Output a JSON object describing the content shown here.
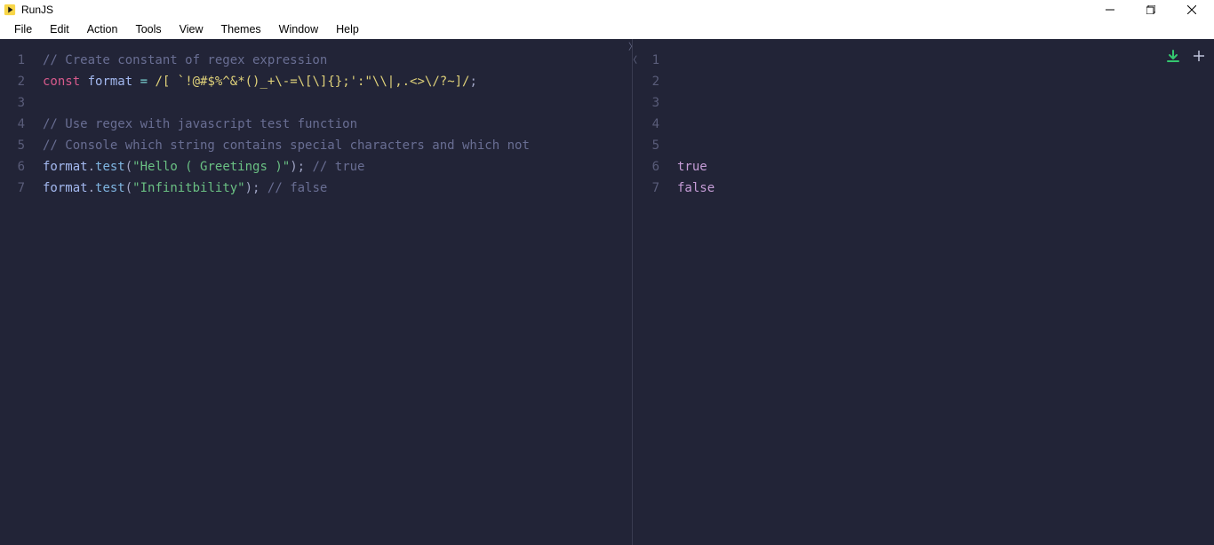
{
  "title_bar": {
    "app_name": "RunJS"
  },
  "menu": {
    "items": [
      "File",
      "Edit",
      "Action",
      "Tools",
      "View",
      "Themes",
      "Window",
      "Help"
    ]
  },
  "editor": {
    "lines": [
      {
        "num": "1",
        "tokens": [
          {
            "cls": "tok-comment",
            "t": "// Create constant of regex expression"
          }
        ]
      },
      {
        "num": "2",
        "tokens": [
          {
            "cls": "tok-keyword",
            "t": "const"
          },
          {
            "cls": "tok-default",
            "t": " "
          },
          {
            "cls": "tok-var",
            "t": "format"
          },
          {
            "cls": "tok-default",
            "t": " "
          },
          {
            "cls": "tok-op",
            "t": "="
          },
          {
            "cls": "tok-default",
            "t": " "
          },
          {
            "cls": "tok-regex",
            "t": "/[ `!@#$%^&*()_+\\-=\\[\\]{};':\"\\\\|,.<>\\/?~]/"
          },
          {
            "cls": "tok-punct",
            "t": ";"
          }
        ]
      },
      {
        "num": "3",
        "tokens": []
      },
      {
        "num": "4",
        "tokens": [
          {
            "cls": "tok-comment",
            "t": "// Use regex with javascript test function"
          }
        ]
      },
      {
        "num": "5",
        "tokens": [
          {
            "cls": "tok-comment",
            "t": "// Console which string contains special characters and which not"
          }
        ]
      },
      {
        "num": "6",
        "tokens": [
          {
            "cls": "tok-var",
            "t": "format"
          },
          {
            "cls": "tok-punct",
            "t": "."
          },
          {
            "cls": "tok-method",
            "t": "test"
          },
          {
            "cls": "tok-punct",
            "t": "("
          },
          {
            "cls": "tok-string",
            "t": "\"Hello ( Greetings )\""
          },
          {
            "cls": "tok-punct",
            "t": ");"
          },
          {
            "cls": "tok-default",
            "t": " "
          },
          {
            "cls": "tok-comment",
            "t": "// true"
          }
        ]
      },
      {
        "num": "7",
        "tokens": [
          {
            "cls": "tok-var",
            "t": "format"
          },
          {
            "cls": "tok-punct",
            "t": "."
          },
          {
            "cls": "tok-method",
            "t": "test"
          },
          {
            "cls": "tok-punct",
            "t": "("
          },
          {
            "cls": "tok-string",
            "t": "\"Infinitbility\""
          },
          {
            "cls": "tok-punct",
            "t": ");"
          },
          {
            "cls": "tok-default",
            "t": " "
          },
          {
            "cls": "tok-comment",
            "t": "// false"
          }
        ]
      }
    ]
  },
  "output": {
    "lines": [
      {
        "num": "1",
        "tokens": []
      },
      {
        "num": "2",
        "tokens": []
      },
      {
        "num": "3",
        "tokens": []
      },
      {
        "num": "4",
        "tokens": []
      },
      {
        "num": "5",
        "tokens": []
      },
      {
        "num": "6",
        "tokens": [
          {
            "cls": "tok-bool",
            "t": "true"
          }
        ]
      },
      {
        "num": "7",
        "tokens": [
          {
            "cls": "tok-bool",
            "t": "false"
          }
        ]
      }
    ]
  },
  "colors": {
    "editor_bg": "#222437",
    "gutter_fg": "#5a5d7a",
    "comment": "#696e93",
    "keyword": "#d85a8c",
    "variable": "#a3b8ef",
    "operator": "#7bd3d3",
    "regex": "#e0d27a",
    "method": "#7fb5e1",
    "string": "#6ac083",
    "punct": "#a0a5c5",
    "bool": "#c59cd6",
    "download_icon": "#34c76f"
  }
}
